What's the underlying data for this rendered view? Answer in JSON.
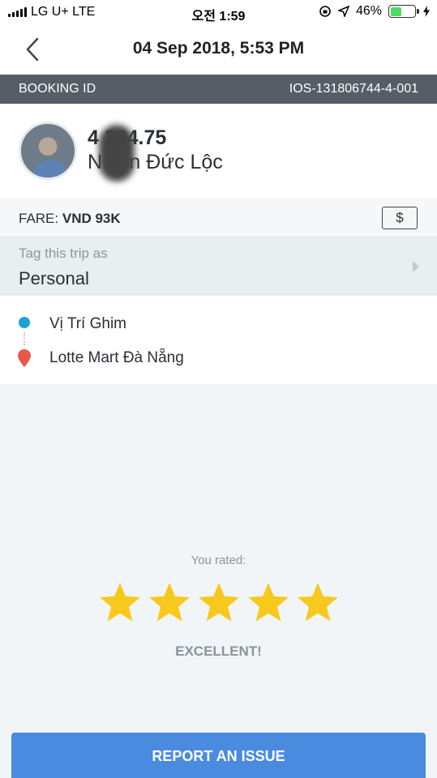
{
  "status_bar": {
    "carrier": "LG U+  LTE",
    "time": "오전 1:59",
    "battery_percent": "46%",
    "battery_level": 0.46
  },
  "header": {
    "title": "04 Sep 2018, 5:53 PM",
    "back_icon": "chevron-left-icon"
  },
  "booking": {
    "label": "BOOKING ID",
    "value": "IOS-131806744-4-001"
  },
  "driver": {
    "rating_text": "4 284.75",
    "name": "N yễn Đức Lộc"
  },
  "fare": {
    "label": "FARE:",
    "amount": "VND 93K",
    "payment_icon": "cash-icon",
    "payment_symbol": "$"
  },
  "tag": {
    "label": "Tag this trip as",
    "value": "Personal"
  },
  "route": {
    "pickup": "Vị Trí Ghim",
    "dropoff": "Lotte Mart Đà Nẵng"
  },
  "rating": {
    "label": "You rated:",
    "stars": 5,
    "max_stars": 5,
    "word": "EXCELLENT!"
  },
  "actions": {
    "report_label": "REPORT AN ISSUE"
  },
  "colors": {
    "accent_blue": "#4a8be0",
    "booking_bar": "#565d66",
    "star": "#f7c91c",
    "pickup": "#1aa3d4",
    "dropoff": "#e8584a"
  }
}
